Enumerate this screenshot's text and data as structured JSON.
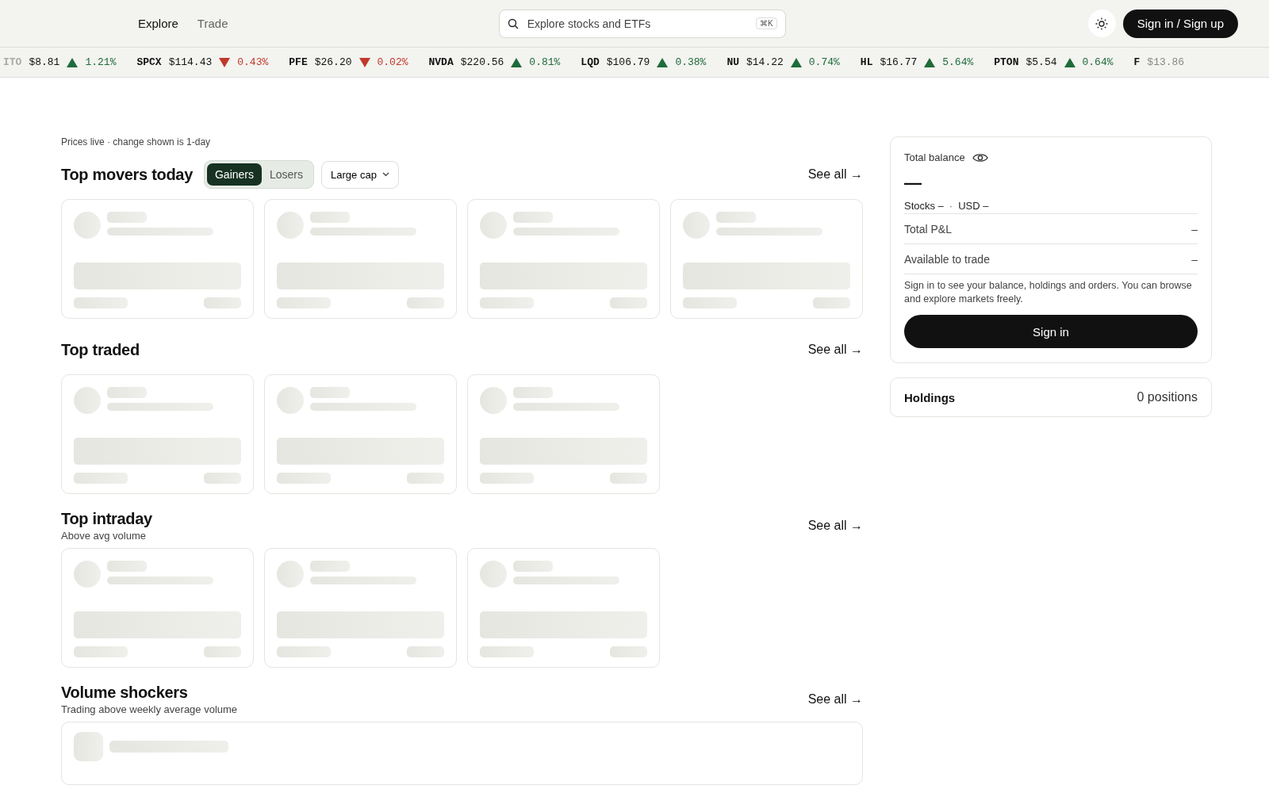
{
  "header": {
    "nav": [
      {
        "label": "Explore",
        "selected": true
      },
      {
        "label": "Trade",
        "selected": false
      }
    ],
    "search": {
      "placeholder": "Explore stocks and ETFs",
      "shortcut": "⌘K"
    },
    "sign_in_button": "Sign in / Sign up"
  },
  "ticker": [
    {
      "symbol": "ITO",
      "price": "$8.81",
      "kind": "up",
      "change": "1.21%"
    },
    {
      "symbol": "SPCX",
      "price": "$114.43",
      "kind": "down",
      "change": "0.43%"
    },
    {
      "symbol": "PFE",
      "price": "$26.20",
      "kind": "down",
      "change": "0.02%"
    },
    {
      "symbol": "NVDA",
      "price": "$220.56",
      "kind": "up",
      "change": "0.81%"
    },
    {
      "symbol": "LQD",
      "price": "$106.79",
      "kind": "up",
      "change": "0.38%"
    },
    {
      "symbol": "NU",
      "price": "$14.22",
      "kind": "up",
      "change": "0.74%"
    },
    {
      "symbol": "HL",
      "price": "$16.77",
      "kind": "up",
      "change": "5.64%"
    },
    {
      "symbol": "PTON",
      "price": "$5.54",
      "kind": "up",
      "change": "0.64%"
    },
    {
      "symbol": "F",
      "price": "$13.86",
      "kind": "cut"
    }
  ],
  "note": "Prices live · change shown is 1-day",
  "sections": [
    {
      "title": "Top movers today",
      "toggle": [
        {
          "label": "Gainers",
          "selected": true
        },
        {
          "label": "Losers",
          "selected": false
        }
      ],
      "dropdown": "Large cap",
      "see_all": "See all →",
      "cards": [
        {
          "kind": "tile"
        },
        {
          "kind": "tile"
        },
        {
          "kind": "tile"
        },
        {
          "kind": "tile"
        }
      ]
    },
    {
      "title": "Top traded",
      "see_all": "See all →",
      "cards": [
        {
          "kind": "tile"
        },
        {
          "kind": "tile"
        },
        {
          "kind": "tile"
        }
      ]
    },
    {
      "title": "Top intraday",
      "subtitle": "Above avg volume",
      "see_all": "See all →",
      "cards": [
        {
          "kind": "tile"
        },
        {
          "kind": "tile"
        },
        {
          "kind": "tile"
        }
      ]
    },
    {
      "title": "Volume shockers",
      "subtitle": "Trading above weekly average volume",
      "see_all": "See all →",
      "cards": [
        {
          "kind": "row"
        }
      ]
    }
  ],
  "balance": {
    "title": "Total balance",
    "value": "—",
    "breakdown": [
      {
        "label": "Stocks –"
      },
      {
        "label": "USD –"
      }
    ],
    "separator": "·",
    "rows": [
      {
        "label": "Total P&L",
        "value": "–"
      },
      {
        "label": "Available to trade",
        "value": "–"
      }
    ],
    "message": "Sign in to see your balance, holdings and orders. You can browse and explore markets freely.",
    "button": "Sign in"
  },
  "holdings": {
    "title": "Holdings",
    "count": "0 positions"
  }
}
